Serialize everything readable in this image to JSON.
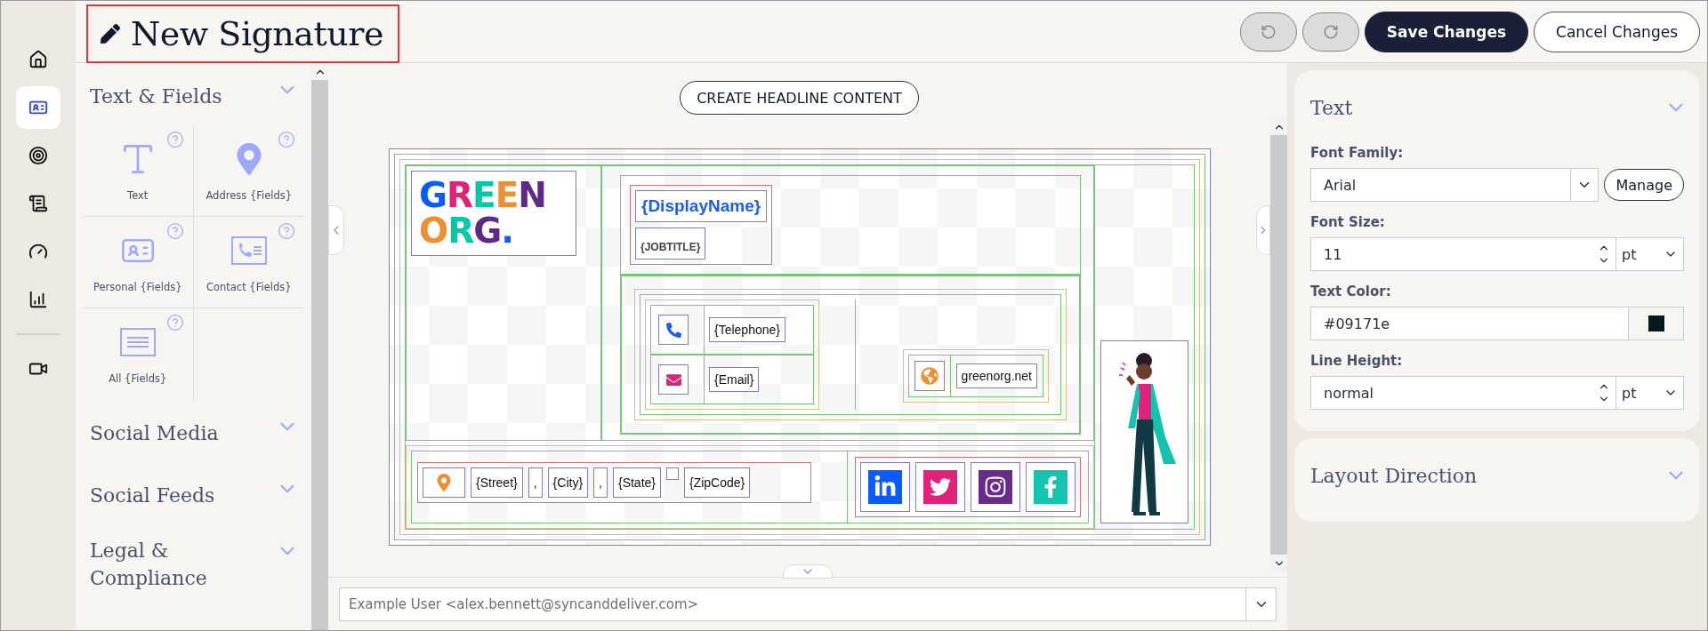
{
  "header": {
    "title": "New Signature",
    "history": [
      {
        "kind": "undo",
        "disabled": true
      },
      {
        "kind": "redo",
        "disabled": true
      }
    ],
    "actions": [
      {
        "label": "Save Changes",
        "kind": "primary"
      },
      {
        "label": "Cancel Changes",
        "kind": "secondary"
      }
    ]
  },
  "rail": {
    "groups": [
      [
        {
          "kind": "home",
          "selected": false
        },
        {
          "kind": "card",
          "selected": true
        },
        {
          "kind": "target",
          "selected": false
        },
        {
          "kind": "scroll",
          "selected": false
        },
        {
          "kind": "gauge",
          "selected": false
        },
        {
          "kind": "chart",
          "selected": false
        }
      ],
      [
        {
          "kind": "video",
          "selected": false
        }
      ]
    ]
  },
  "left_panel": {
    "sections": [
      {
        "title": "Text & Fields",
        "items": [
          {
            "kind": "text",
            "label": "Text"
          },
          {
            "kind": "address",
            "label": "Address {Fields}"
          },
          {
            "kind": "personal",
            "label": "Personal {Fields}"
          },
          {
            "kind": "contact",
            "label": "Contact {Fields}"
          },
          {
            "kind": "all",
            "label": "All {Fields}"
          }
        ]
      },
      {
        "title": "Social Media"
      },
      {
        "title": "Social Feeds"
      },
      {
        "title": "Legal & Compliance"
      }
    ]
  },
  "canvas": {
    "headline_button": "CREATE HEADLINE CONTENT",
    "signature": {
      "logo": [
        [
          {
            "text": "G",
            "color": "#0a5cff"
          },
          {
            "text": "R",
            "color": "#e0227a"
          },
          {
            "text": "E",
            "color": "#00c9a7"
          },
          {
            "text": "E",
            "color": "#ed8f33"
          },
          {
            "text": "N",
            "color": "#5f2a84"
          }
        ],
        [
          {
            "text": "O",
            "color": "#ed8f33"
          },
          {
            "text": "R",
            "color": "#00c9a7"
          },
          {
            "text": "G",
            "color": "#5f2a84"
          },
          {
            "text": ".",
            "color": "#0a5cff"
          }
        ]
      ],
      "display_name": "{DisplayName}",
      "job_title": "{JOBTITLE}",
      "contacts": [
        {
          "kind": "phone",
          "value": "{Telephone}",
          "color": "#1a5cf0"
        },
        {
          "kind": "email",
          "value": "{Email}",
          "color": "#e0227a"
        }
      ],
      "website": {
        "kind": "web",
        "value": "greenorg.net",
        "color": "#ed8f33"
      },
      "address": [
        {
          "kind": "pin",
          "color": "#ed8f33"
        },
        {
          "kind": "text",
          "text": "{Street}"
        },
        {
          "kind": "text",
          "text": ","
        },
        {
          "kind": "text",
          "text": "{City}"
        },
        {
          "kind": "text",
          "text": ","
        },
        {
          "kind": "text",
          "text": "{State}"
        },
        {
          "kind": "empty"
        },
        {
          "kind": "text",
          "text": "{ZipCode}"
        }
      ],
      "socials": [
        {
          "kind": "linkedin",
          "color": "#0a5cff"
        },
        {
          "kind": "twitter",
          "color": "#e0227a"
        },
        {
          "kind": "instagram",
          "color": "#6a2a8a"
        },
        {
          "kind": "facebook",
          "color": "#13c4b0"
        }
      ],
      "illustration": {
        "kind": "person"
      }
    },
    "sender": {
      "value": "Example User <alex.bennett@syncanddeliver.com>"
    }
  },
  "right_panel": {
    "sections": [
      {
        "title": "Text",
        "fields": [
          {
            "kind": "select",
            "label": "Font Family:",
            "value": "Arial",
            "button": "Manage"
          },
          {
            "kind": "number",
            "label": "Font Size:",
            "value": "11",
            "unit": "pt"
          },
          {
            "kind": "color",
            "label": "Text Color:",
            "value": "#09171e",
            "color": "#09171e"
          },
          {
            "kind": "number",
            "label": "Line Height:",
            "value": "normal",
            "unit": "pt"
          }
        ]
      },
      {
        "title": "Layout Direction"
      }
    ]
  }
}
